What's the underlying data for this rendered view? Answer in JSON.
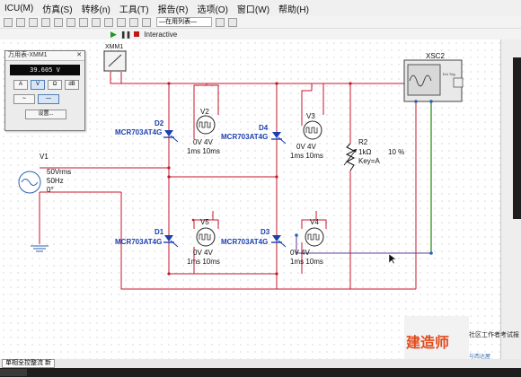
{
  "menubar": {
    "items": [
      "ICU(M)",
      "仿真(S)",
      "转移(n)",
      "工具(T)",
      "报告(R)",
      "选项(O)",
      "窗口(W)",
      "帮助(H)"
    ]
  },
  "toolbar2": {
    "combo_label": "—在用列表—",
    "mode_label": "Interactive"
  },
  "multimeter": {
    "title": "万用表-XMM1",
    "reading": "39.605 V",
    "mode_buttons": [
      "A",
      "V",
      "Ω",
      "dB"
    ],
    "settings_label": "设置..."
  },
  "schematic": {
    "xmm1": "XMM1",
    "xsc2": "XSC2",
    "v1_ref": "V1",
    "v1_line1": "50Vrms",
    "v1_line2": "50Hz",
    "v1_line3": "0°",
    "d1_ref": "D1",
    "d1_part": "MCR703AT4G",
    "d2_ref": "D2",
    "d2_part": "MCR703AT4G",
    "d3_ref": "D3",
    "d3_part": "MCR703AT4G",
    "d4_ref": "D4",
    "d4_part": "MCR703AT4G",
    "v2_ref": "V2",
    "v2_line1": "0V 4V",
    "v2_line2": "1ms 10ms",
    "v3_ref": "V3",
    "v3_line1": "0V 4V",
    "v3_line2": "1ms 10ms",
    "v4_ref": "V4",
    "v4_line1": "0V 4V",
    "v4_line2": "1ms 10ms",
    "v5_ref": "V5",
    "v5_line1": "0V 4V",
    "v5_line2": "1ms 10ms",
    "r2_ref": "R2",
    "r2_value": "1kΩ",
    "r2_key": "Key=A",
    "r2_percent": "10 %",
    "scope_ext": "Ext Trig"
  },
  "tabbar": {
    "tab_label": "单相全控整流 新"
  },
  "watermark": {
    "logo": "建造师",
    "text": "社区工作者考试报",
    "sub": "与西达屋"
  },
  "colors": {
    "wire_red": "#c4172c",
    "wire_green": "#3f9a2a",
    "wire_purple": "#5a3d96",
    "label_blue": "#1a3fb0",
    "menu_bg": "#f0f0f0"
  }
}
